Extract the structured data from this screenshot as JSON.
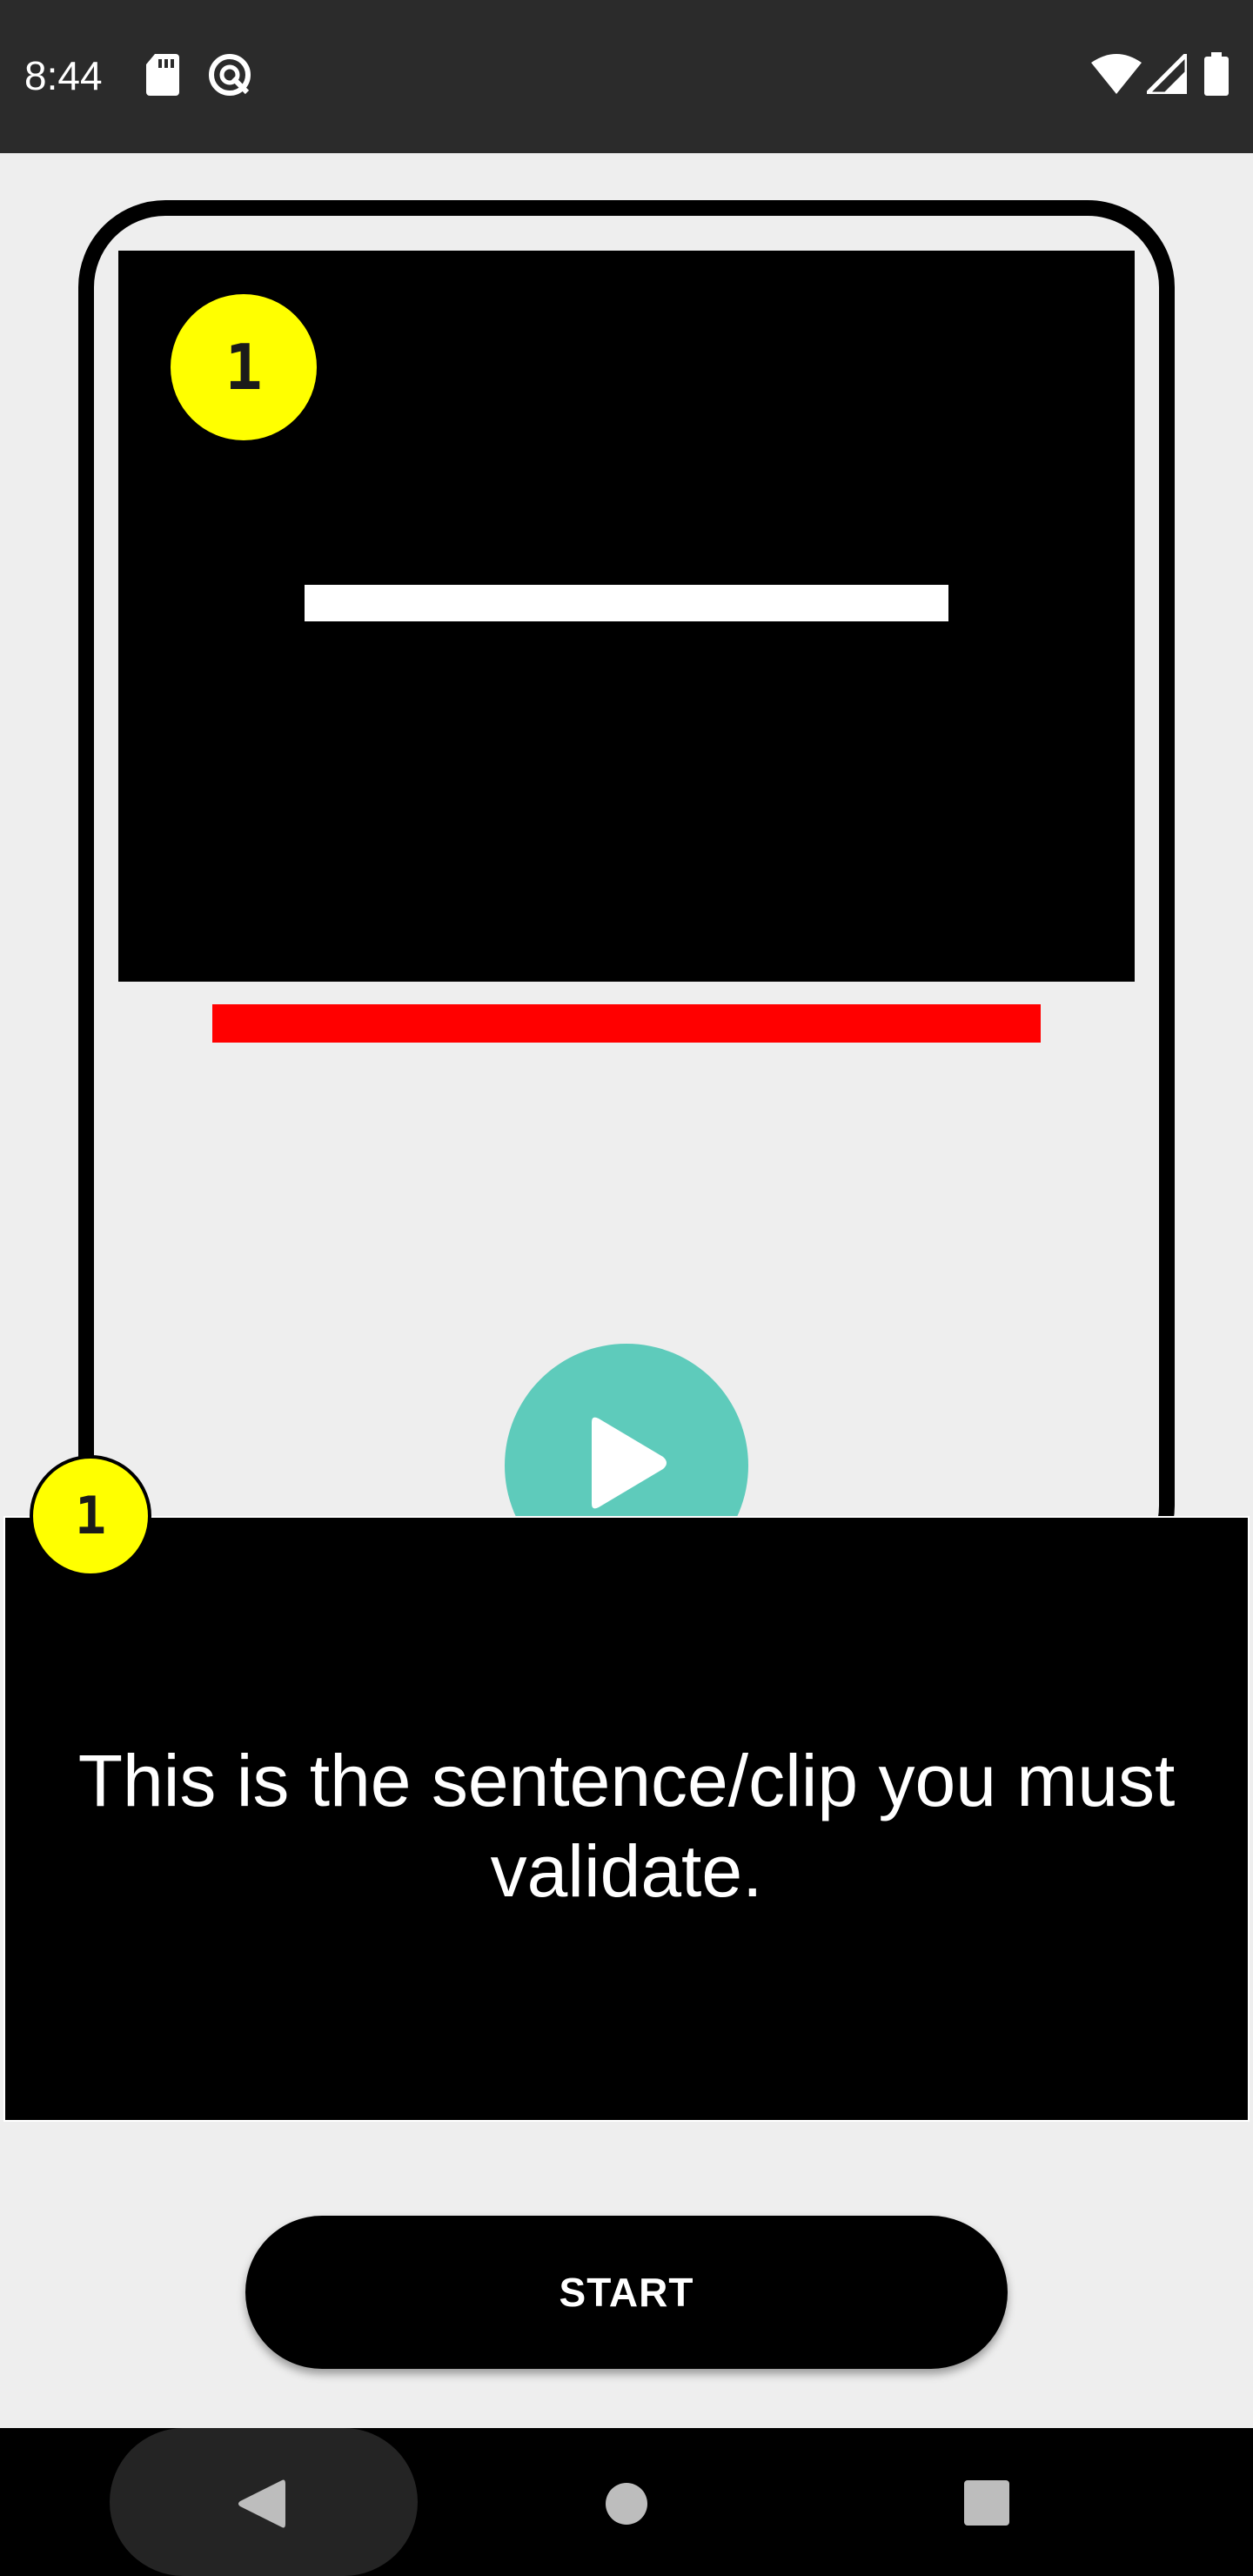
{
  "status_bar": {
    "time": "8:44",
    "left_icons": [
      "sd-card-icon",
      "data-saver-icon"
    ],
    "right_icons": [
      "wifi-icon",
      "cell-signal-icon",
      "battery-icon"
    ]
  },
  "illustration": {
    "step_number": "1",
    "progress_color": "#ff0000",
    "play_button_color": "#5ecbbb"
  },
  "tooltip": {
    "step_number": "1",
    "text": "This is the sentence/clip you must validate."
  },
  "start_button": {
    "label": "START"
  },
  "nav_bar": {
    "items": [
      "back-icon",
      "home-icon",
      "recents-icon"
    ]
  },
  "colors": {
    "status_bar_bg": "#2b2b2b",
    "page_bg": "#eeeeee",
    "badge_yellow": "#ffff00"
  }
}
